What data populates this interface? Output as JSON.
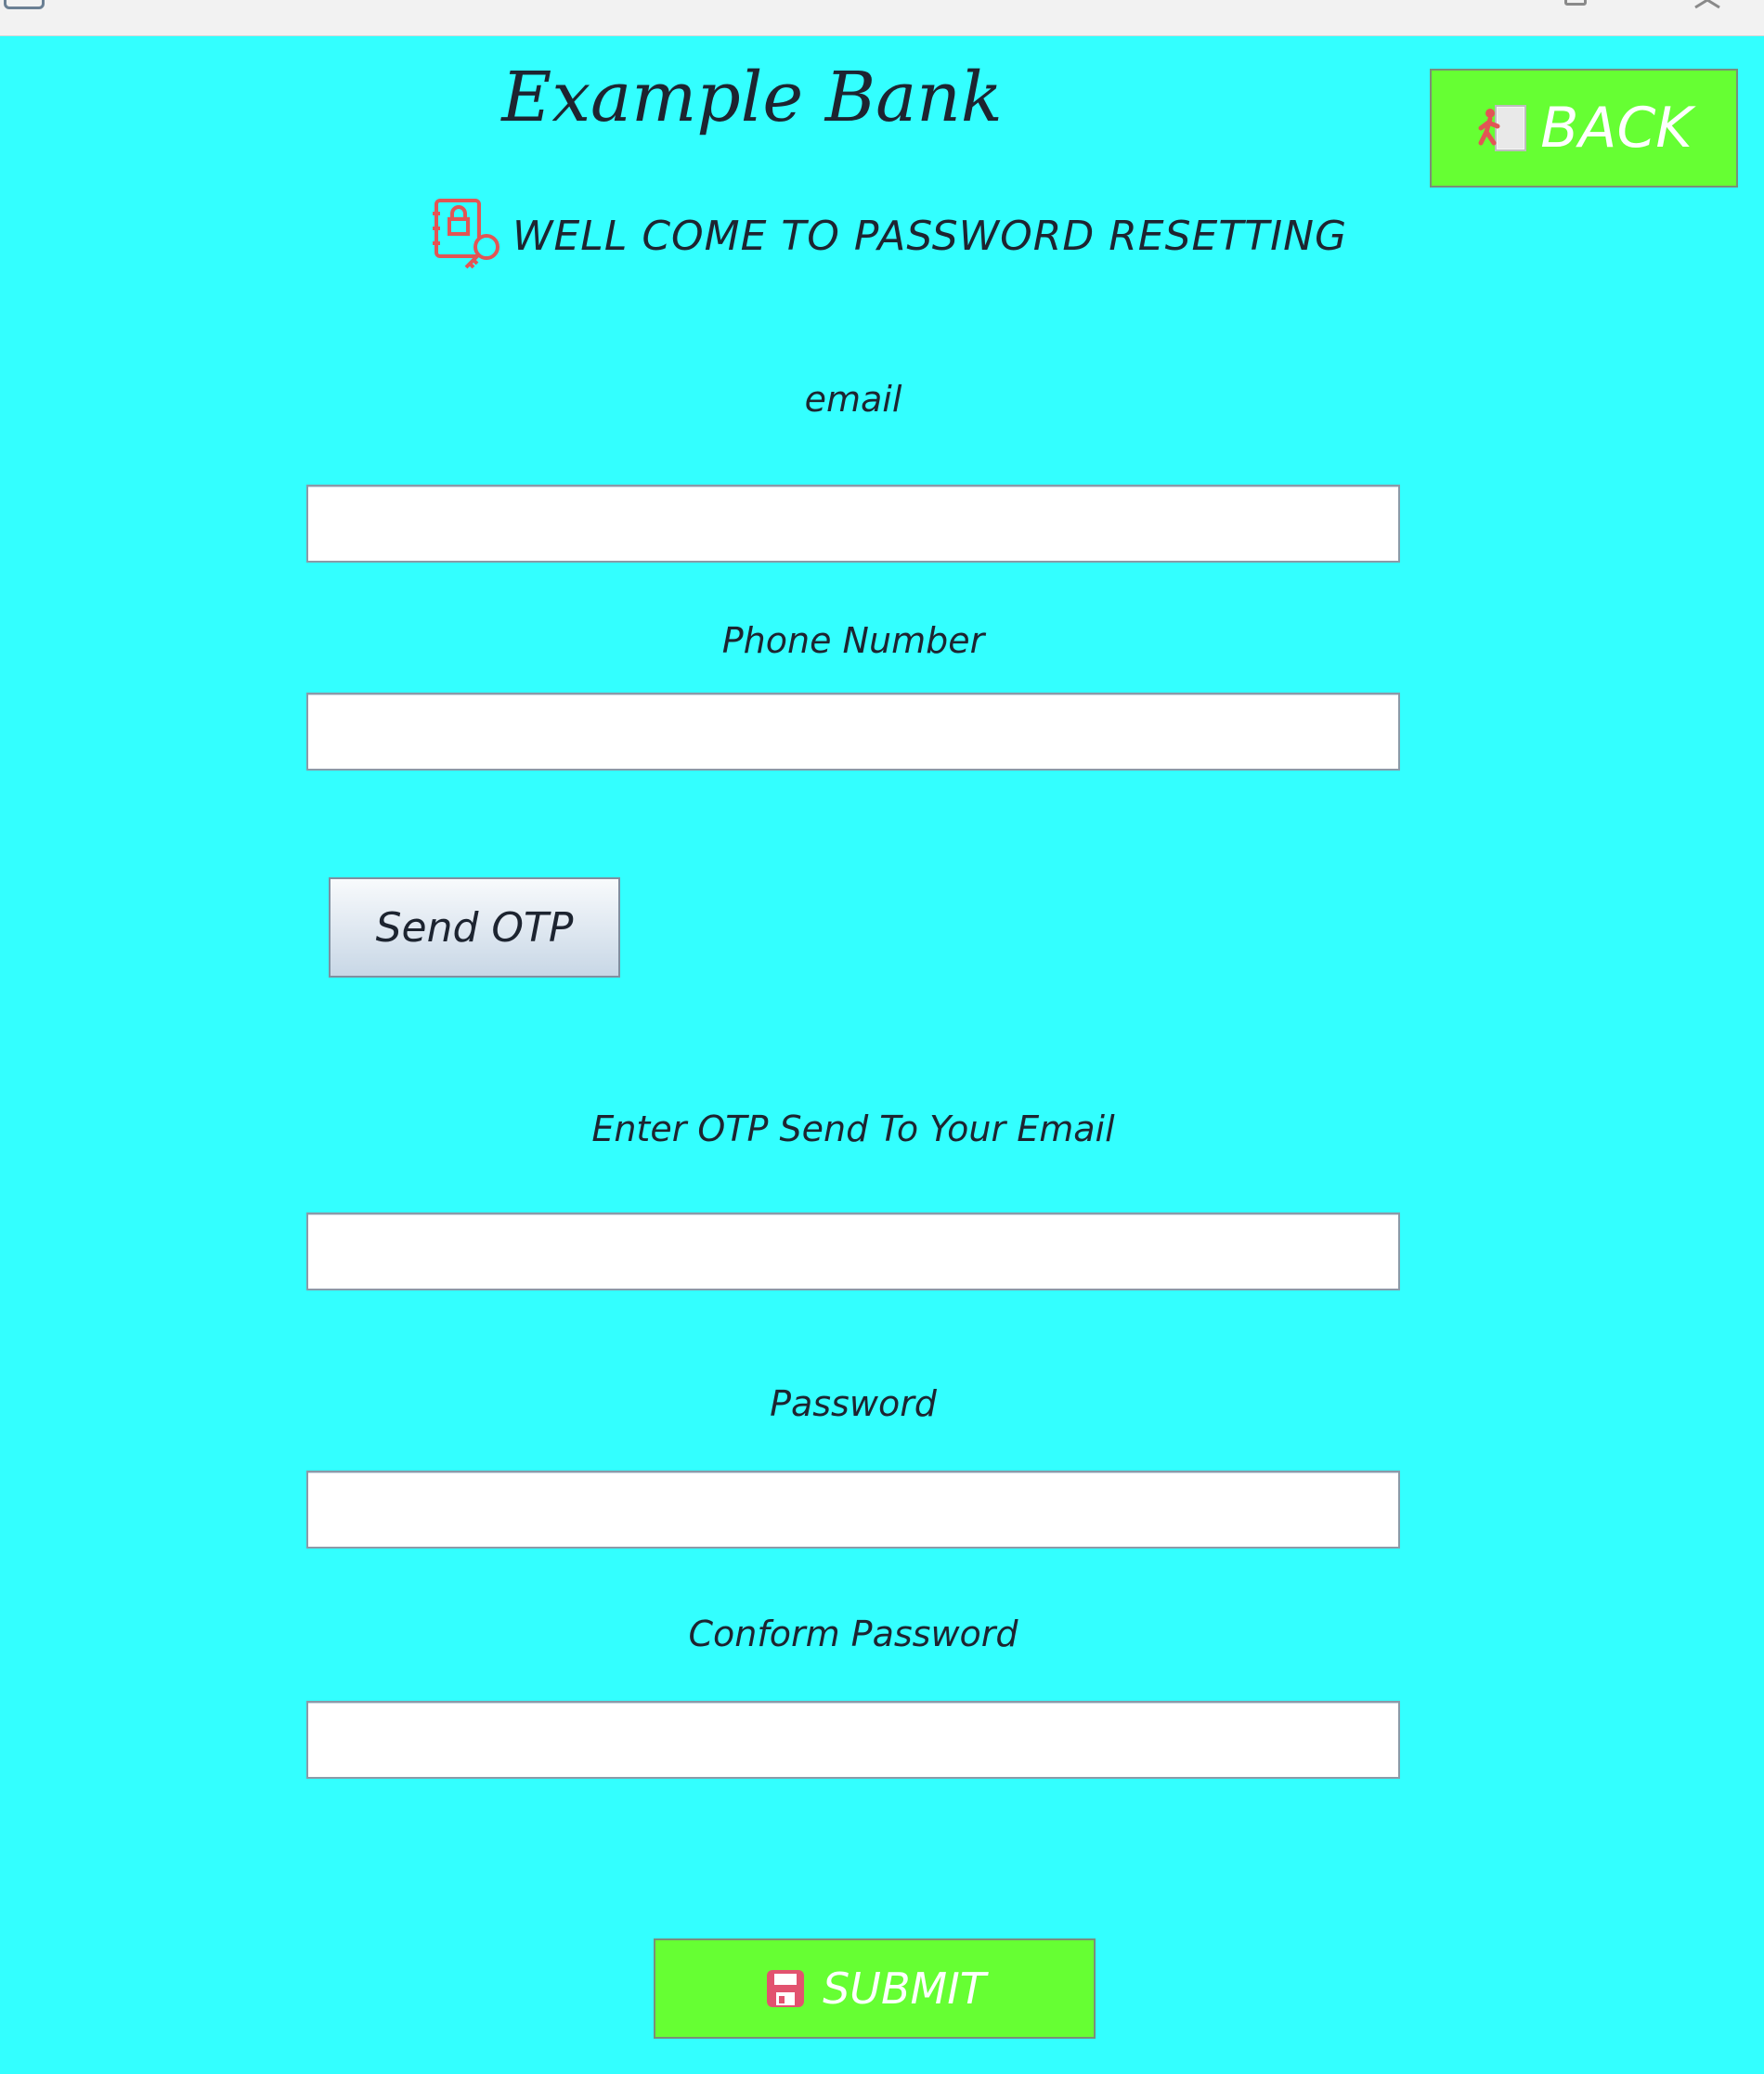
{
  "window": {
    "app_icon": "app-window-icon",
    "controls": [
      "maximize-icon",
      "close-icon"
    ]
  },
  "header": {
    "bank_title": "Example Bank",
    "back_label": "BACK",
    "back_icon": "exit-door-icon"
  },
  "welcome": {
    "text": "WELL COME TO PASSWORD RESETTING",
    "icon": "lock-key-icon"
  },
  "form": {
    "email_label": "email",
    "email_value": "",
    "phone_label": "Phone Number",
    "phone_value": "",
    "send_otp_label": "Send OTP",
    "otp_label": "Enter OTP Send To Your Email",
    "otp_value": "",
    "password_label": "Password",
    "password_value": "",
    "confirm_label": "Conform Password",
    "confirm_value": "",
    "submit_label": "SUBMIT",
    "submit_icon": "floppy-disk-icon"
  },
  "colors": {
    "background": "#33ffff",
    "button_green": "#66ff33",
    "text_dark": "#1d2430",
    "icon_red": "#e25555"
  }
}
